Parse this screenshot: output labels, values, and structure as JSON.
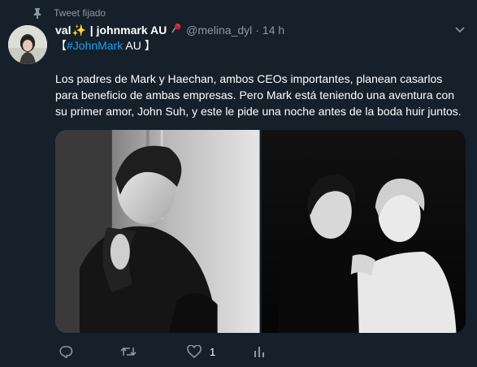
{
  "pinned_label": "Tweet fijado",
  "author": {
    "name_prefix": "val",
    "name_sparkle": "✨",
    "name_suffix": " | johnmark AU",
    "handle": "@melina_dyl",
    "separator": "·",
    "time": "14 h"
  },
  "tag_line": {
    "open_bracket": "【",
    "hashtag": "#JohnMark",
    "rest": " AU 】"
  },
  "body": "Los padres de Mark y Haechan, ambos CEOs importantes, planean casarlos para beneficio de ambas empresas. Pero Mark está teniendo una aventura con su primer amor, John Suh, y este le pide una noche antes de la boda huir juntos.",
  "actions": {
    "like_count": "1"
  },
  "colors": {
    "background": "#15202b",
    "muted": "#8899a6",
    "link": "#1da1f2"
  },
  "icons": [
    "pin-icon",
    "sparkle-icon",
    "pushpin-icon",
    "chevron-down-icon",
    "reply-icon",
    "retweet-icon",
    "heart-icon",
    "analytics-icon"
  ]
}
